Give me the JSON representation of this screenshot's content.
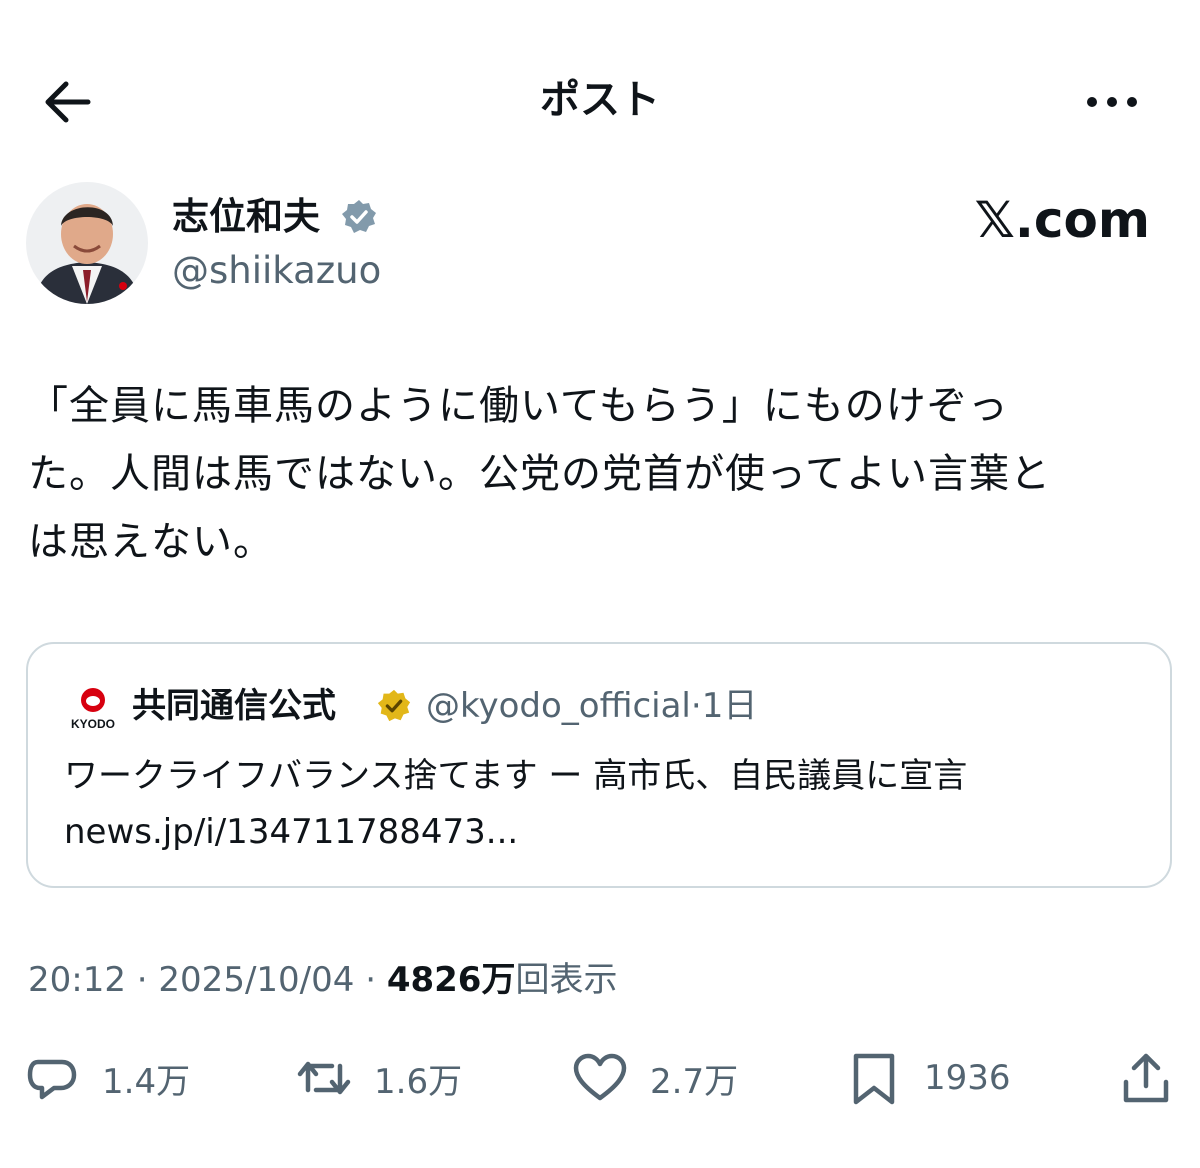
{
  "header": {
    "title": "ポスト",
    "back_icon": "arrow-left-icon",
    "more_icon": "more-horizontal-icon"
  },
  "author": {
    "name": "志位和夫",
    "handle": "@shiikazuo",
    "verified": true
  },
  "watermark": "𝕏.com",
  "post": {
    "lines": [
      "「全員に馬車馬のように働いてもらう」にものけぞっ",
      "た。人間は馬ではない。公党の党首が使ってよい言葉と",
      "は思えない。"
    ]
  },
  "quote": {
    "logo_label": "KYODO",
    "name": "共同通信公式",
    "handle": "@kyodo_official",
    "separator": "·",
    "time": "1日",
    "text": "ワークライフバランス捨てます ー 高市氏、自民議員に宣言",
    "link": "news.jp/i/134711788473..."
  },
  "meta": {
    "time": "20:12",
    "date": "2025/10/04",
    "views_count": "4826万",
    "views_label": "回表示",
    "separator": "·"
  },
  "actions": {
    "reply": "1.4万",
    "repost": "1.6万",
    "like": "2.7万",
    "bookmark": "1936"
  },
  "colors": {
    "text": "#0f1419",
    "secondary": "#536471",
    "border": "#cfd9de",
    "verified_blue": "#829aab",
    "verified_gold": "#e2b719",
    "kyodo_red": "#d7000f"
  }
}
